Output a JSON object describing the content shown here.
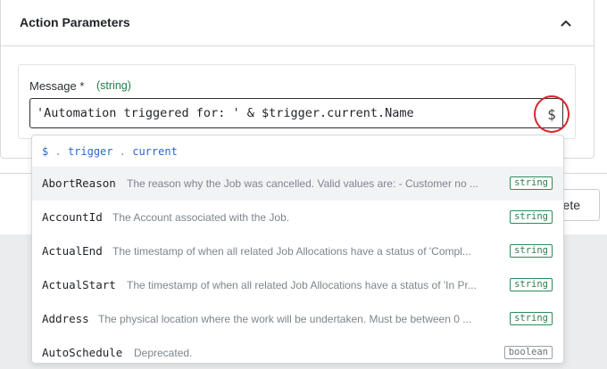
{
  "panel": {
    "title": "Action Parameters"
  },
  "field": {
    "label": "Message *",
    "type": "(string)",
    "value": "'Automation triggered for: ' & $trigger.current.Name",
    "insert_symbol": "$"
  },
  "footer": {
    "delete_label": "Delete"
  },
  "dropdown": {
    "path": {
      "root": "$",
      "segment1": "trigger",
      "segment2": "current",
      "separator": "."
    },
    "items": [
      {
        "name": "AbortReason",
        "description": "The reason why the Job was cancelled. Valid values are: - Customer no ...",
        "type": "string",
        "highlighted": true
      },
      {
        "name": "AccountId",
        "description": "The Account associated with the Job.",
        "type": "string",
        "highlighted": false
      },
      {
        "name": "ActualEnd",
        "description": "The timestamp of when all related Job Allocations have a status of 'Compl...",
        "type": "string",
        "highlighted": false
      },
      {
        "name": "ActualStart",
        "description": "The timestamp of when all related Job Allocations have a status of 'In Pr...",
        "type": "string",
        "highlighted": false
      },
      {
        "name": "Address",
        "description": "The physical location where the work will be undertaken. Must be between 0 ...",
        "type": "string",
        "highlighted": false
      },
      {
        "name": "AutoSchedule",
        "description": "Deprecated.",
        "type": "boolean",
        "highlighted": false
      }
    ]
  },
  "colors": {
    "accent_highlight": "#d9262b",
    "type_green": "#1b7f4a",
    "path_blue": "#2a68c9"
  }
}
